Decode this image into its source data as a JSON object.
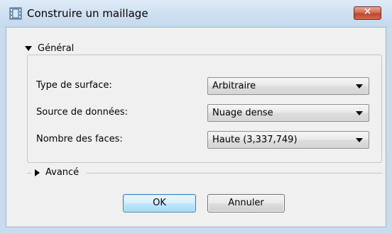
{
  "window": {
    "title": "Construire un maillage",
    "close_glyph": "✕",
    "icon": "film-icon"
  },
  "general": {
    "header": "Général",
    "expanded": true,
    "rows": [
      {
        "label": "Type de surface:",
        "value": "Arbitraire"
      },
      {
        "label": "Source de données:",
        "value": "Nuage dense"
      },
      {
        "label": "Nombre des faces:",
        "value": "Haute (3,337,749)"
      }
    ]
  },
  "advanced": {
    "header": "Avancé",
    "expanded": false
  },
  "buttons": {
    "ok": "OK",
    "cancel": "Annuler"
  },
  "colors": {
    "title_bar": "#cddff0",
    "close_button": "#c7462c",
    "dialog_bg": "#f0f0f0",
    "ok_border": "#3c7fb1"
  }
}
